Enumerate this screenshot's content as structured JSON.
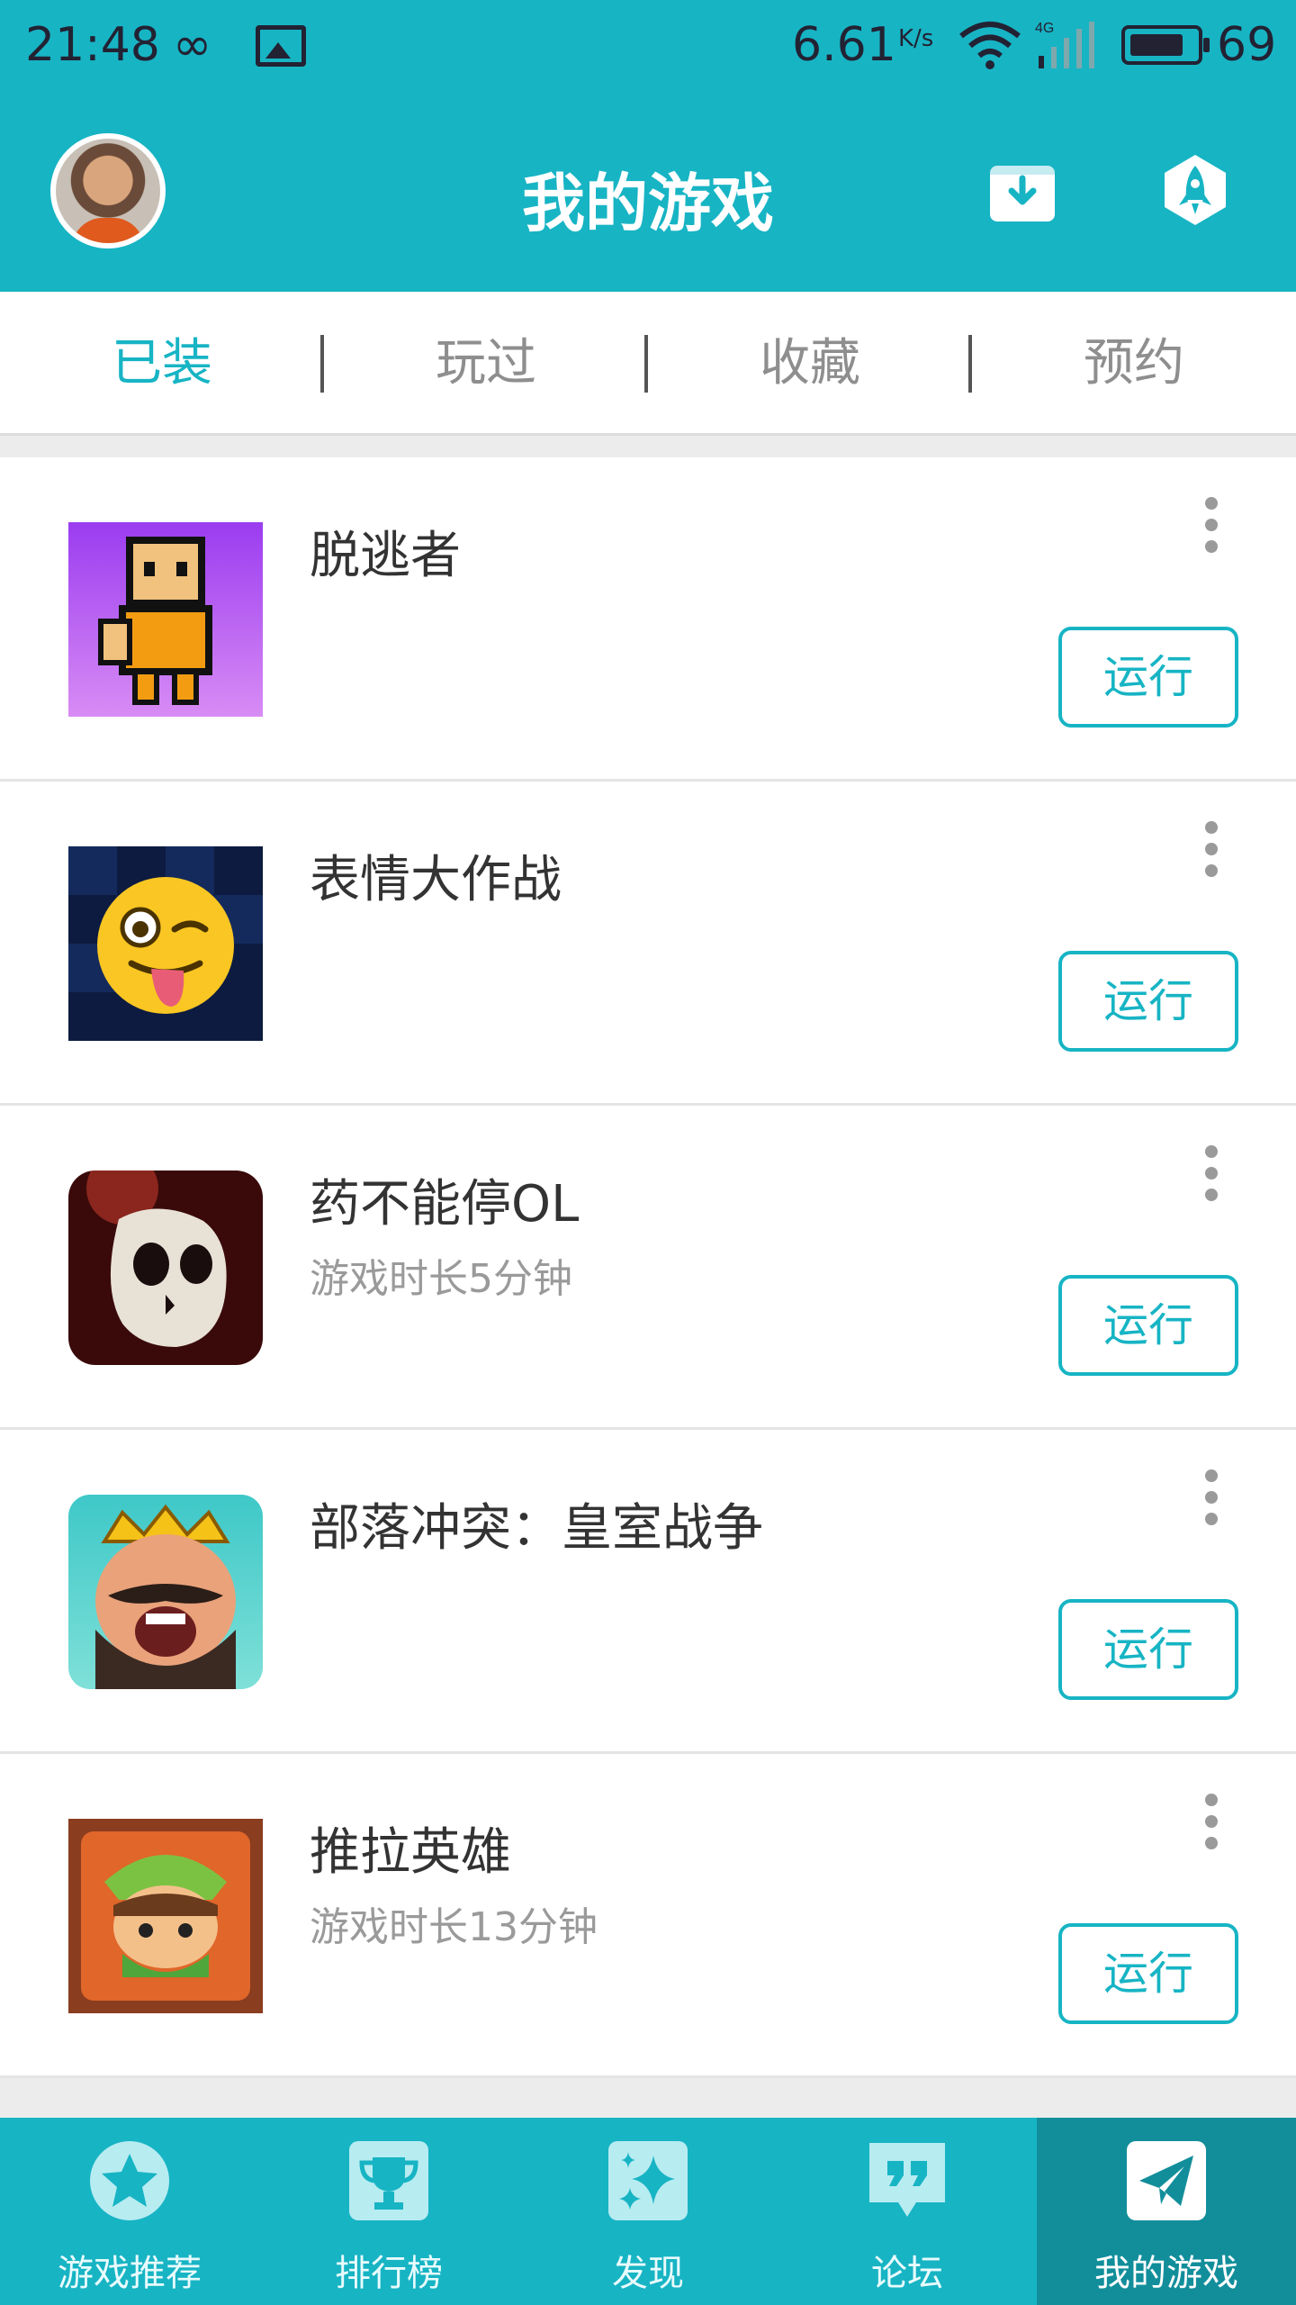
{
  "status_bar": {
    "time": "21:48",
    "infinity": "∞",
    "net_speed": "6.61",
    "net_unit": "K/s",
    "network_type": "4G",
    "battery_level": "69"
  },
  "header": {
    "title": "我的游戏"
  },
  "tabs": [
    {
      "label": "已装",
      "active": true
    },
    {
      "label": "玩过",
      "active": false
    },
    {
      "label": "收藏",
      "active": false
    },
    {
      "label": "预约",
      "active": false
    }
  ],
  "games": [
    {
      "name": "脱逃者",
      "playtime": "",
      "action": "运行",
      "icon": "escapists-icon"
    },
    {
      "name": "表情大作战",
      "playtime": "",
      "action": "运行",
      "icon": "emoji-wink-icon"
    },
    {
      "name": "药不能停OL",
      "playtime": "游戏时长5分钟",
      "action": "运行",
      "icon": "skull-icon"
    },
    {
      "name": "部落冲突：皇室战争",
      "playtime": "",
      "action": "运行",
      "icon": "clash-royale-king-icon"
    },
    {
      "name": "推拉英雄",
      "playtime": "游戏时长13分钟",
      "action": "运行",
      "icon": "push-hero-icon"
    }
  ],
  "bottom_nav": [
    {
      "label": "游戏推荐",
      "icon": "star-icon",
      "active": false
    },
    {
      "label": "排行榜",
      "icon": "trophy-icon",
      "active": false
    },
    {
      "label": "发现",
      "icon": "sparkle-icon",
      "active": false
    },
    {
      "label": "论坛",
      "icon": "quote-icon",
      "active": false
    },
    {
      "label": "我的游戏",
      "icon": "paper-plane-icon",
      "active": true
    }
  ],
  "colors": {
    "primary": "#17b4c4",
    "nav_active": "#128e9b",
    "text": "#333333",
    "muted": "#9a9a9a"
  }
}
